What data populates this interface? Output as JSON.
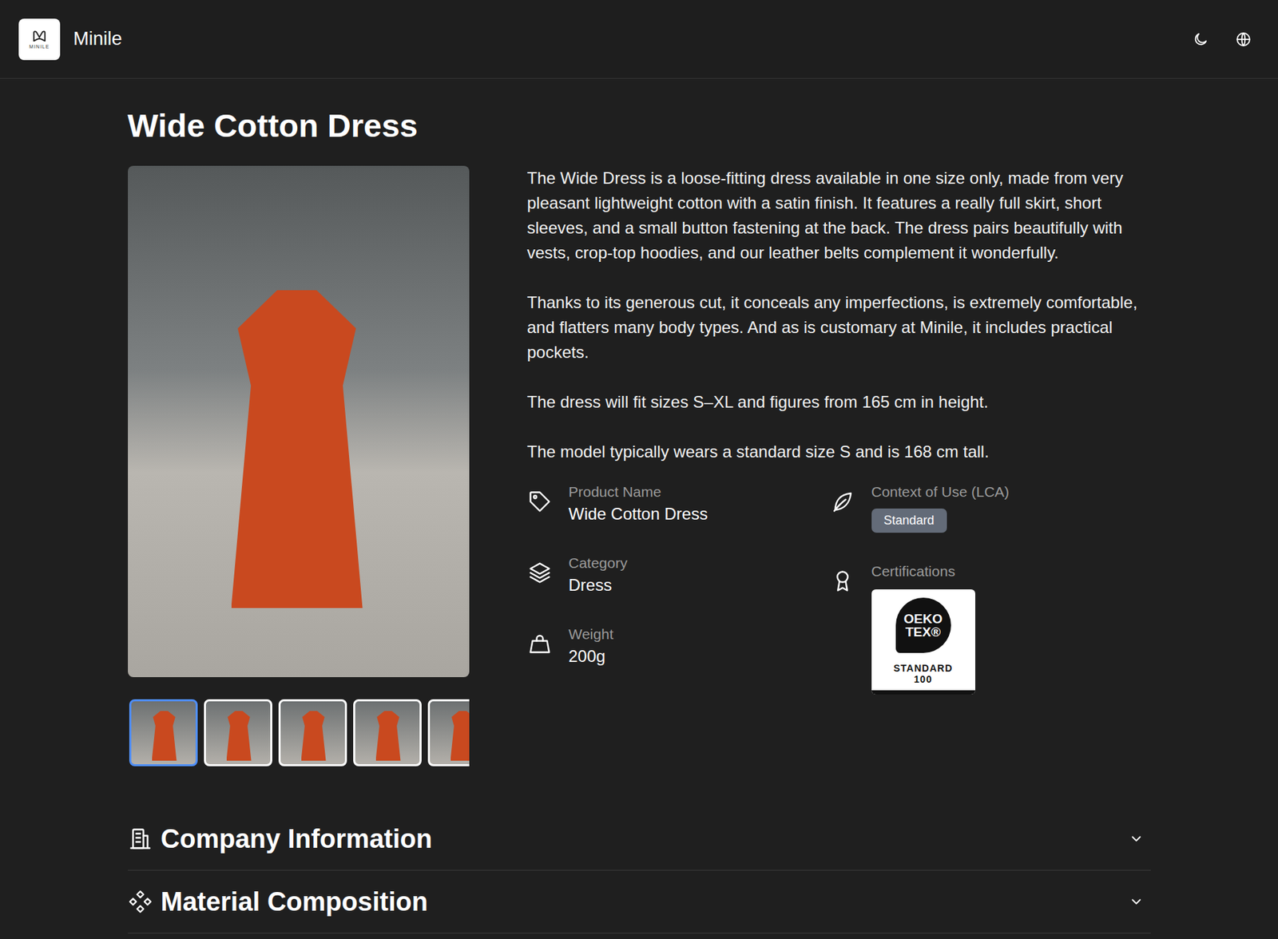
{
  "header": {
    "brand": "Minile",
    "logo_caption": "MINILE"
  },
  "title": "Wide Cotton Dress",
  "gallery": {
    "thumbnails": [
      {
        "selected": true
      },
      {
        "selected": false
      },
      {
        "selected": false
      },
      {
        "selected": false
      },
      {
        "selected": false
      }
    ]
  },
  "description": [
    "The Wide Dress is a loose-fitting dress available in one size only, made from very pleasant lightweight cotton with a satin finish. It features a really full skirt, short sleeves, and a small button fastening at the back. The dress pairs beautifully with vests, crop-top hoodies, and our leather belts complement it wonderfully.",
    "Thanks to its generous cut, it conceals any imperfections, is extremely comfortable, and flatters many body types. And as is customary at Minile, it includes practical pockets.",
    "The dress will fit sizes S–XL and figures from 165 cm in height.",
    "The model typically wears a standard size S and is 168 cm tall."
  ],
  "specs": {
    "left": [
      {
        "label": "Product Name",
        "value": "Wide Cotton Dress"
      },
      {
        "label": "Category",
        "value": "Dress"
      },
      {
        "label": "Weight",
        "value": "200g"
      }
    ],
    "right": [
      {
        "kind": "badge",
        "label": "Context of Use (LCA)",
        "value": "Standard"
      },
      {
        "kind": "certificate",
        "label": "Certifications",
        "mark": [
          "OEKO",
          "TEX®"
        ],
        "caption": [
          "STANDARD",
          "100"
        ]
      }
    ]
  },
  "sections": [
    {
      "title": "Company Information",
      "expanded": false
    },
    {
      "title": "Material Composition",
      "expanded": false
    }
  ]
}
